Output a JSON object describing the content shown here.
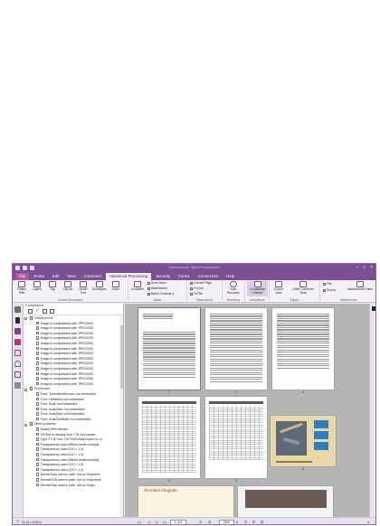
{
  "window": {
    "title": "Document.pdf - Nitro Pro Advanced"
  },
  "menu": {
    "tabs": [
      "File",
      "Home",
      "Edit",
      "View",
      "Comment",
      "Advanced Processing",
      "Security",
      "Forms",
      "Connectors",
      "Help"
    ],
    "active": "Advanced Processing"
  },
  "ribbon": {
    "current_document": {
      "label": "Current Document",
      "buttons": [
        "Flatten Pdfs",
        "Layers",
        "Tag",
        "Clip Art",
        "Model Tree",
        "Envelopes",
        "Index"
      ]
    },
    "batch": {
      "label": "Batch",
      "converter": "Converter",
      "scan_inbox": "Scan Inbox",
      "watchfolder": "Watchfolder",
      "batch_controls": "Batch Controls"
    },
    "read_aloud": {
      "label": "Read Aloud",
      "current_page": "Current Page",
      "to_end": "To End",
      "to_file": "To File"
    },
    "recovery": {
      "label": "Recovery",
      "auto_recovery": "Auto Recovery"
    },
    "compliance": {
      "label": "Compliance",
      "compliance_checker": "Compliance Checker"
    },
    "export": {
      "label": "Export",
      "export_area": "Export Area",
      "other_converter_tools": "Other Converter Tools"
    },
    "attachments": {
      "label": "Attachments",
      "file": "File",
      "sound": "Sound",
      "attachments_panel": "Attachments Panel"
    }
  },
  "panel": {
    "header": "Compliance",
    "tree": [
      {
        "type": "cat",
        "text": "Critical errors"
      },
      {
        "type": "item",
        "text": "Image is compressed with JPEG2000"
      },
      {
        "type": "item",
        "text": "Image is compressed with JPEG2000"
      },
      {
        "type": "item",
        "text": "Image is compressed with JPEG2000"
      },
      {
        "type": "item",
        "text": "Image is compressed with JPEG2000"
      },
      {
        "type": "item",
        "text": "Image is compressed with JPEG2000"
      },
      {
        "type": "item",
        "text": "Image is compressed with JPEG2000"
      },
      {
        "type": "item",
        "text": "Image is compressed with JPEG2000"
      },
      {
        "type": "item",
        "text": "Image is compressed with JPEG2000"
      },
      {
        "type": "item",
        "text": "Image is compressed with JPEG2000"
      },
      {
        "type": "item",
        "text": "Image is compressed with JPEG2000"
      },
      {
        "type": "item",
        "text": "Image is compressed with JPEG2000"
      },
      {
        "type": "item",
        "text": "Image is compressed with JPEG2000"
      },
      {
        "type": "item",
        "text": "Image is compressed with JPEG2000"
      },
      {
        "type": "cat",
        "text": "Font errors"
      },
      {
        "type": "item",
        "text": "Font: 'TimesNewRoman' not embedded"
      },
      {
        "type": "item",
        "text": "Font: 'Helvetica' not embedded"
      },
      {
        "type": "item",
        "text": "Font: 'Arial' not embedded"
      },
      {
        "type": "item",
        "text": "Font: 'Arial,Italic' not embedded"
      },
      {
        "type": "item",
        "text": "Font: 'Arial,Bold' not embedded"
      },
      {
        "type": "item",
        "text": "Font: 'Arial,BoldItalic' not embedded"
      },
      {
        "type": "cat",
        "text": "Other problems"
      },
      {
        "type": "item",
        "text": "Invalid XRef stream."
      },
      {
        "type": "item",
        "text": "CIDSet is missing from CID font subset"
      },
      {
        "type": "item",
        "text": "Type 2 CID font: CIDToGIDMap invalid or m"
      },
      {
        "type": "item",
        "text": "Transparency used (Blend mode=multiply"
      },
      {
        "type": "item",
        "text": "Transparency used (CA != 1.0)"
      },
      {
        "type": "item",
        "text": "Transparency used (CA != 1.0)"
      },
      {
        "type": "item",
        "text": "Transparency used (Blend mode=multiply"
      },
      {
        "type": "item",
        "text": "Transparency used (CA != 1.0)"
      },
      {
        "type": "item",
        "text": "Transparency used (CA != 1.0)"
      },
      {
        "type": "item",
        "text": "DeviceGray used in path, but no OutputInt"
      },
      {
        "type": "item",
        "text": "DeviceRGB used in path, but no OutputInte"
      },
      {
        "type": "item",
        "text": "DeviceGray used in path, but no Outpu"
      }
    ]
  },
  "pages": {
    "numbers": [
      "1",
      "2",
      "3",
      "4",
      "5",
      "6"
    ],
    "diagram_title": "Accident Diagram"
  },
  "status": {
    "page_size": "11.24 x 8.26 in",
    "page_indicator": "1 of 6",
    "zoom": "26%"
  },
  "colors": {
    "accent": "#7a4f93",
    "file_tab": "#b05a9e"
  }
}
